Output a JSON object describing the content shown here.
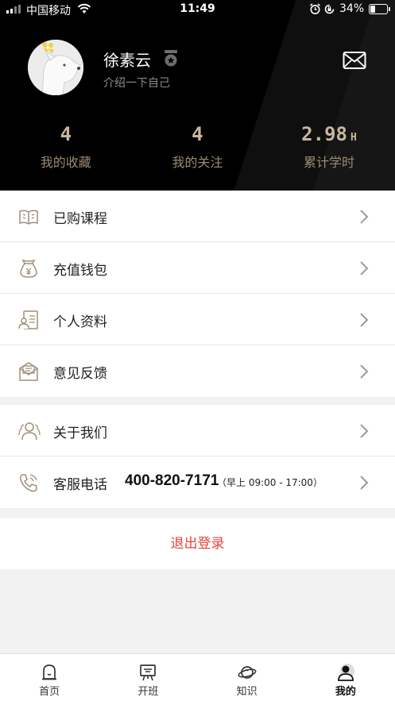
{
  "status_bar": {
    "carrier": "中国移动",
    "time": "11:49",
    "battery_percent": "34%",
    "battery_level": 0.34
  },
  "profile": {
    "name": "徐素云",
    "bio": "介绍一下自己",
    "stats": [
      {
        "value": "4",
        "unit": "",
        "label": "我的收藏"
      },
      {
        "value": "4",
        "unit": "",
        "label": "我的关注"
      },
      {
        "value": "2.98",
        "unit": "H",
        "label": "累计学时"
      }
    ]
  },
  "menu_group_1": [
    {
      "label": "已购课程",
      "icon": "book-icon"
    },
    {
      "label": "充值钱包",
      "icon": "wallet-icon"
    },
    {
      "label": "个人资料",
      "icon": "profile-card-icon"
    },
    {
      "label": "意见反馈",
      "icon": "feedback-envelope-icon"
    }
  ],
  "menu_group_2": [
    {
      "label": "关于我们",
      "icon": "people-icon"
    },
    {
      "label": "客服电话",
      "icon": "phone-icon",
      "phone": "400-820-7171",
      "hours": "（早上 09:00 - 17:00）"
    }
  ],
  "logout_label": "退出登录",
  "bottom_nav": [
    {
      "label": "首页",
      "icon": "home-icon"
    },
    {
      "label": "开班",
      "icon": "classroom-icon"
    },
    {
      "label": "知识",
      "icon": "planet-icon"
    },
    {
      "label": "我的",
      "icon": "user-icon",
      "active": true
    }
  ],
  "colors": {
    "accent_gold": "#c9b79c",
    "logout_red": "#e8423a",
    "header_bg": "#000000"
  }
}
